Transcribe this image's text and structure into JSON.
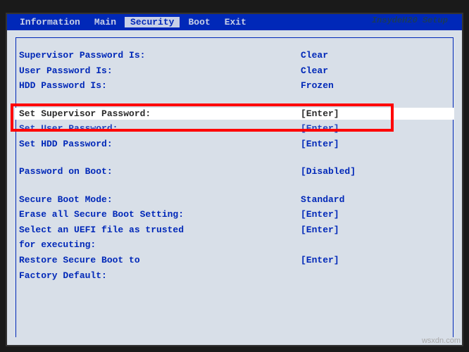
{
  "brand": "InsydeH20 Setup",
  "menu": {
    "items": [
      {
        "label": "Information"
      },
      {
        "label": "Main"
      },
      {
        "label": "Security",
        "active": true
      },
      {
        "label": "Boot"
      },
      {
        "label": "Exit"
      }
    ]
  },
  "security": {
    "supervisor_password_is": {
      "label": "Supervisor Password Is:",
      "value": "Clear"
    },
    "user_password_is": {
      "label": "User Password Is:",
      "value": "Clear"
    },
    "hdd_password_is": {
      "label": "HDD Password Is:",
      "value": "Frozen"
    },
    "set_supervisor_password": {
      "label": "Set Supervisor Password:",
      "value": "[Enter]"
    },
    "set_user_password": {
      "label": "Set User Password:",
      "value": "[Enter]"
    },
    "set_hdd_password": {
      "label": "Set HDD Password:",
      "value": "[Enter]"
    },
    "password_on_boot": {
      "label": "Password on Boot:",
      "value": "[Disabled]"
    },
    "secure_boot_mode": {
      "label": "Secure Boot Mode:",
      "value": "Standard"
    },
    "erase_secure_boot": {
      "label": "Erase all Secure Boot Setting:",
      "value": "[Enter]"
    },
    "select_uefi_file": {
      "label": "Select an UEFI file as trusted",
      "value": "[Enter]"
    },
    "select_uefi_file_cont": {
      "label": "for executing:",
      "value": ""
    },
    "restore_secure_boot": {
      "label": "Restore Secure Boot to",
      "value": "[Enter]"
    },
    "restore_secure_boot_cont": {
      "label": "Factory Default:",
      "value": ""
    }
  },
  "watermark": "wsxdn.com"
}
